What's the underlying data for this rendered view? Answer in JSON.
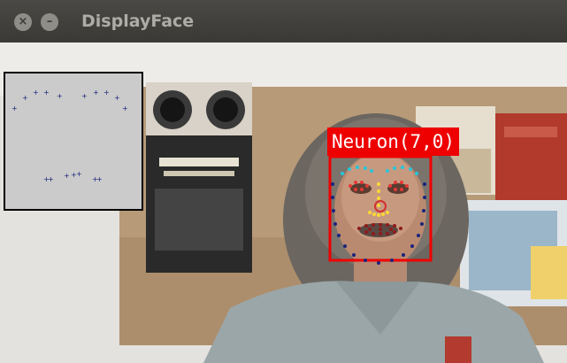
{
  "window": {
    "title": "DisplayFace",
    "close_glyph": "×",
    "minimize_glyph": "–"
  },
  "detection": {
    "label": "Neuron(7,0)"
  },
  "colors": {
    "detection_box": "#ee0000",
    "preview_bg": "#cbcbcb",
    "landmark_jaw": "#1a237e",
    "landmark_eyes": "#d32f2f",
    "landmark_brows": "#26c6da",
    "landmark_nose": "#fdd835"
  }
}
